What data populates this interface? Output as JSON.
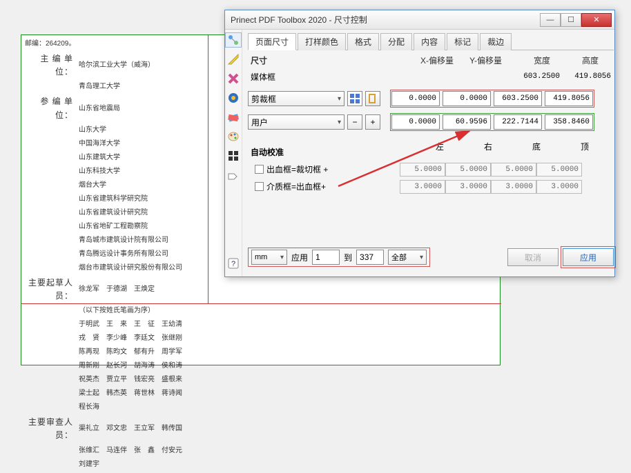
{
  "window": {
    "title": "Prinect PDF Toolbox 2020 - 尺寸控制"
  },
  "tabs": [
    "页面尺寸",
    "打样颜色",
    "格式",
    "分配",
    "内容",
    "标记",
    "裁边"
  ],
  "size": {
    "title": "尺寸",
    "headers": [
      "X-偏移量",
      "Y-偏移量",
      "宽度",
      "高度"
    ],
    "media_label": "媒体框",
    "media_w": "603.2500",
    "media_h": "419.8056",
    "crop_label": "剪裁框",
    "crop": [
      "0.0000",
      "0.0000",
      "603.2500",
      "419.8056"
    ],
    "user_label": "用户",
    "user": [
      "0.0000",
      "60.9596",
      "222.7144",
      "358.8460"
    ]
  },
  "autocal": {
    "title": "自动校准",
    "headers": [
      "左",
      "右",
      "底",
      "顶"
    ],
    "bleed_label": "出血框=裁切框 +",
    "bleed": [
      "5.0000",
      "5.0000",
      "5.0000",
      "5.0000"
    ],
    "media_label": "介质框=出血框+",
    "media": [
      "3.0000",
      "3.0000",
      "3.0000",
      "3.0000"
    ]
  },
  "bottom": {
    "unit": "mm",
    "apply_label": "应用",
    "from": "1",
    "to_label": "到",
    "to": "337",
    "scope": "全部",
    "cancel": "取消",
    "apply": "应用"
  },
  "doc": {
    "postcode": "邮编：264209。",
    "r1_lab": "主 编 单 位：",
    "r1_val": "哈尔滨工业大学（威海）",
    "r1b": "青岛理工大学",
    "r2_lab": "参 编 单 位：",
    "r2_val": "山东省地震局",
    "units": [
      "山东大学",
      "中国海洋大学",
      "山东建筑大学",
      "山东科技大学",
      "烟台大学",
      "山东省建筑科学研究院",
      "山东省建筑设计研究院",
      "山东省地矿工程勘察院",
      "青岛城市建筑设计院有限公司",
      "青岛腾远设计事务所有限公司",
      "烟台市建筑设计研究股份有限公司"
    ],
    "r3_lab": "主要起草人员：",
    "r3_val": "徐龙军　于德湖　王焕定",
    "r3b": "（以下按姓氏笔画为序）",
    "people": [
      "于明武　王　来　王　征　王幼清",
      "戎　贤　李少峰　李廷文　张继刚",
      "陈再现　陈昀文　郁有升　周学军",
      "周新刚　赵长河　胡海涛　侯和涛",
      "祝英杰　贾立平　钱宏亮　盛根来",
      "梁士起　韩杰英　蒋世林　蒋诗闻",
      "程长海"
    ],
    "r4_lab": "主要审查人员：",
    "r4_val": "渠礼立　邓文忠　王立军　韩传国",
    "rev": [
      "张维汇　马连伴　张　鑫　付安元",
      "刘建宇"
    ]
  }
}
